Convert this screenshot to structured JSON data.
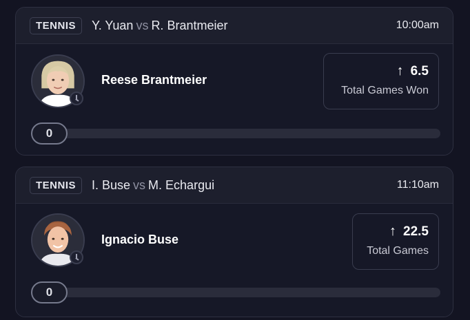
{
  "cards": [
    {
      "sport": "TENNIS",
      "player_a": "Y. Yuan",
      "vs": "vs",
      "player_b": "R. Brantmeier",
      "time": "10:00am",
      "player_name": "Reese Brantmeier",
      "line": "6.5",
      "direction_icon": "arrow-up-icon",
      "stat_label": "Total Games Won",
      "progress_value": "0",
      "progress_fraction": 0
    },
    {
      "sport": "TENNIS",
      "player_a": "I. Buse",
      "vs": "vs",
      "player_b": "M. Echargui",
      "time": "11:10am",
      "player_name": "Ignacio Buse",
      "line": "22.5",
      "direction_icon": "arrow-up-icon",
      "stat_label": "Total Games",
      "progress_value": "0",
      "progress_fraction": 0
    }
  ],
  "colors": {
    "background": "#131422",
    "card": "#161827",
    "header": "#1d1f2d",
    "border": "#2e3041",
    "track": "#2a2c3b"
  }
}
